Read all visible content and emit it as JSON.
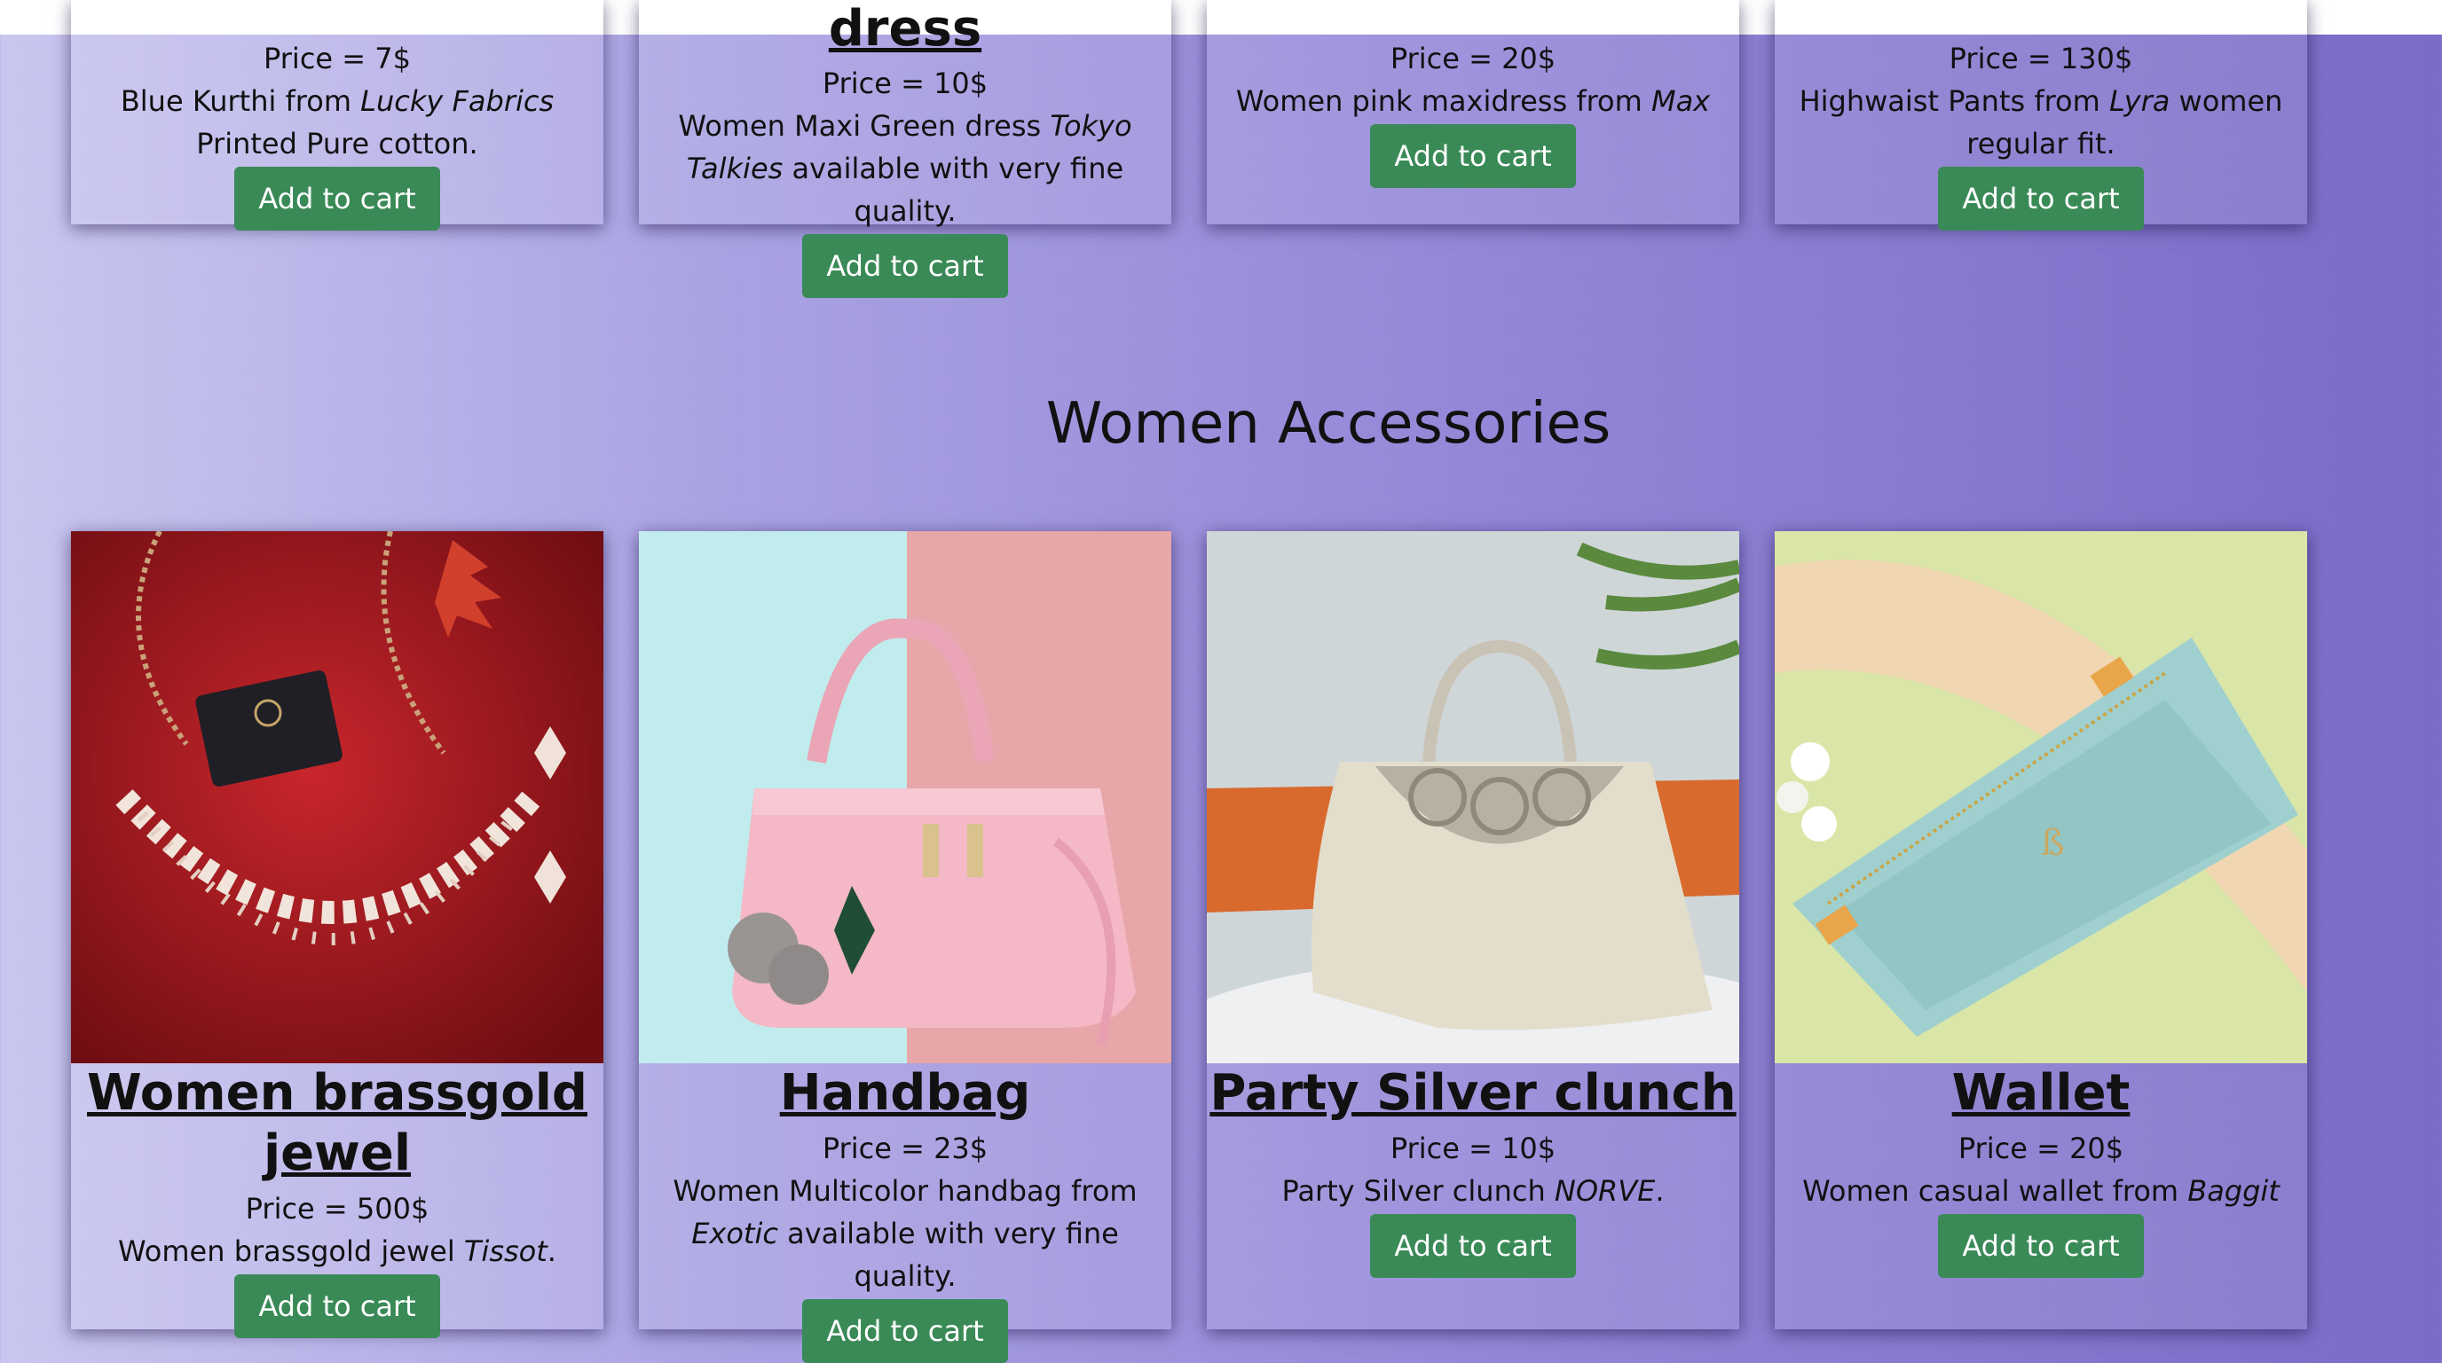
{
  "top_products": [
    {
      "title": "",
      "price": "Price = 7$",
      "desc_pre": "Blue Kurthi from ",
      "desc_em": "Lucky Fabrics",
      "desc_post": " Printed Pure cotton.",
      "button": "Add to cart"
    },
    {
      "title": "dress",
      "price": "Price = 10$",
      "desc_pre": "Women Maxi Green dress ",
      "desc_em": "Tokyo Talkies",
      "desc_post": " available with very fine quality.",
      "button": "Add to cart"
    },
    {
      "title": "",
      "price": "Price = 20$",
      "desc_pre": "Women pink maxidress from ",
      "desc_em": "Max",
      "desc_post": "",
      "button": "Add to cart"
    },
    {
      "title": "",
      "price": "Price = 130$",
      "desc_pre": "Highwaist Pants from ",
      "desc_em": "Lyra",
      "desc_post": " women regular fit.",
      "button": "Add to cart"
    }
  ],
  "accessories": {
    "heading": "Women Accessories",
    "products": [
      {
        "title": "Women brassgold jewel",
        "price": "Price = 500$",
        "desc_pre": "Women brassgold jewel ",
        "desc_em": "Tissot",
        "desc_post": ".",
        "button": "Add to cart",
        "image_icon": "necklace-image"
      },
      {
        "title": "Handbag",
        "price": "Price = 23$",
        "desc_pre": "Women Multicolor handbag from ",
        "desc_em": "Exotic",
        "desc_post": " available with very fine quality.",
        "button": "Add to cart",
        "image_icon": "handbag-image"
      },
      {
        "title": "Party Silver clunch",
        "price": "Price = 10$",
        "desc_pre": "Party Silver clunch ",
        "desc_em": "NORVE",
        "desc_post": ".",
        "button": "Add to cart",
        "image_icon": "clutch-image"
      },
      {
        "title": "Wallet",
        "price": "Price = 20$",
        "desc_pre": "Women casual wallet from ",
        "desc_em": "Baggit",
        "desc_post": "",
        "button": "Add to cart",
        "image_icon": "wallet-image"
      }
    ]
  },
  "colors": {
    "button_bg": "#3a8a57",
    "button_text": "#ffffff",
    "gradient_start": "#c9c6ef",
    "gradient_end": "#7a6cc7"
  }
}
